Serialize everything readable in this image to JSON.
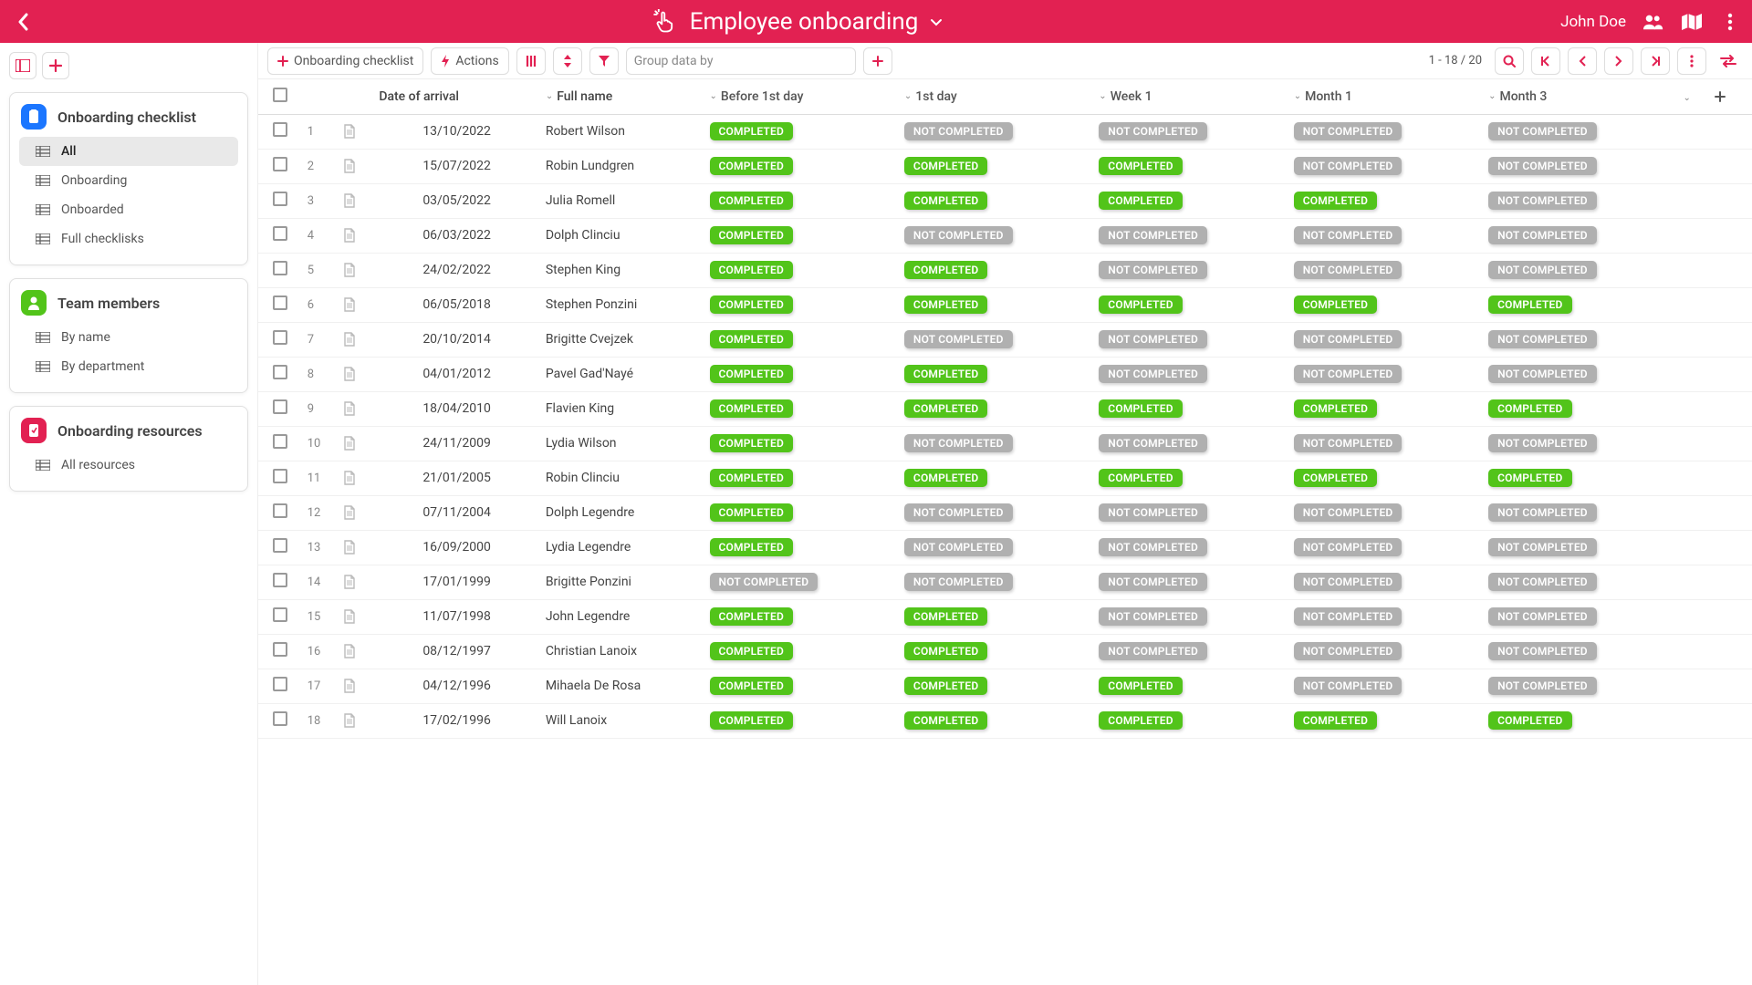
{
  "header": {
    "title": "Employee onboarding",
    "username": "John Doe"
  },
  "sidebar": {
    "sections": [
      {
        "title": "Onboarding checklist",
        "iconColor": "bg-blue",
        "items": [
          {
            "label": "All",
            "active": true
          },
          {
            "label": "Onboarding",
            "active": false
          },
          {
            "label": "Onboarded",
            "active": false
          },
          {
            "label": "Full checklisks",
            "active": false
          }
        ]
      },
      {
        "title": "Team members",
        "iconColor": "bg-green",
        "items": [
          {
            "label": "By name",
            "active": false
          },
          {
            "label": "By department",
            "active": false
          }
        ]
      },
      {
        "title": "Onboarding resources",
        "iconColor": "bg-red",
        "items": [
          {
            "label": "All resources",
            "active": false
          }
        ]
      }
    ]
  },
  "toolbar": {
    "newLabel": "Onboarding checklist",
    "actionsLabel": "Actions",
    "groupLabel": "Group data by",
    "pageInfo": "1 - 18 / 20"
  },
  "table": {
    "columns": [
      "Date of arrival",
      "Full name",
      "Before 1st day",
      "1st day",
      "Week 1",
      "Month 1",
      "Month 3"
    ],
    "statuses": {
      "c": "COMPLETED",
      "n": "NOT COMPLETED"
    },
    "rows": [
      {
        "n": 1,
        "date": "13/10/2022",
        "name": "Robert Wilson",
        "s": [
          "c",
          "n",
          "n",
          "n",
          "n"
        ]
      },
      {
        "n": 2,
        "date": "15/07/2022",
        "name": "Robin Lundgren",
        "s": [
          "c",
          "c",
          "c",
          "n",
          "n"
        ]
      },
      {
        "n": 3,
        "date": "03/05/2022",
        "name": "Julia Romell",
        "s": [
          "c",
          "c",
          "c",
          "c",
          "n"
        ]
      },
      {
        "n": 4,
        "date": "06/03/2022",
        "name": "Dolph Clinciu",
        "s": [
          "c",
          "n",
          "n",
          "n",
          "n"
        ]
      },
      {
        "n": 5,
        "date": "24/02/2022",
        "name": "Stephen King",
        "s": [
          "c",
          "c",
          "n",
          "n",
          "n"
        ]
      },
      {
        "n": 6,
        "date": "06/05/2018",
        "name": "Stephen Ponzini",
        "s": [
          "c",
          "c",
          "c",
          "c",
          "c"
        ]
      },
      {
        "n": 7,
        "date": "20/10/2014",
        "name": "Brigitte Cvejzek",
        "s": [
          "c",
          "n",
          "n",
          "n",
          "n"
        ]
      },
      {
        "n": 8,
        "date": "04/01/2012",
        "name": "Pavel Gad'Nayé",
        "s": [
          "c",
          "c",
          "n",
          "n",
          "n"
        ]
      },
      {
        "n": 9,
        "date": "18/04/2010",
        "name": "Flavien King",
        "s": [
          "c",
          "c",
          "c",
          "c",
          "c"
        ]
      },
      {
        "n": 10,
        "date": "24/11/2009",
        "name": "Lydia Wilson",
        "s": [
          "c",
          "n",
          "n",
          "n",
          "n"
        ]
      },
      {
        "n": 11,
        "date": "21/01/2005",
        "name": "Robin Clinciu",
        "s": [
          "c",
          "c",
          "c",
          "c",
          "c"
        ]
      },
      {
        "n": 12,
        "date": "07/11/2004",
        "name": "Dolph Legendre",
        "s": [
          "c",
          "n",
          "n",
          "n",
          "n"
        ]
      },
      {
        "n": 13,
        "date": "16/09/2000",
        "name": "Lydia Legendre",
        "s": [
          "c",
          "n",
          "n",
          "n",
          "n"
        ]
      },
      {
        "n": 14,
        "date": "17/01/1999",
        "name": "Brigitte Ponzini",
        "s": [
          "n",
          "n",
          "n",
          "n",
          "n"
        ]
      },
      {
        "n": 15,
        "date": "11/07/1998",
        "name": "John Legendre",
        "s": [
          "c",
          "c",
          "n",
          "n",
          "n"
        ]
      },
      {
        "n": 16,
        "date": "08/12/1997",
        "name": "Christian Lanoix",
        "s": [
          "c",
          "c",
          "n",
          "n",
          "n"
        ]
      },
      {
        "n": 17,
        "date": "04/12/1996",
        "name": "Mihaela De Rosa",
        "s": [
          "c",
          "c",
          "c",
          "n",
          "n"
        ]
      },
      {
        "n": 18,
        "date": "17/02/1996",
        "name": "Will Lanoix",
        "s": [
          "c",
          "c",
          "c",
          "c",
          "c"
        ]
      }
    ]
  }
}
